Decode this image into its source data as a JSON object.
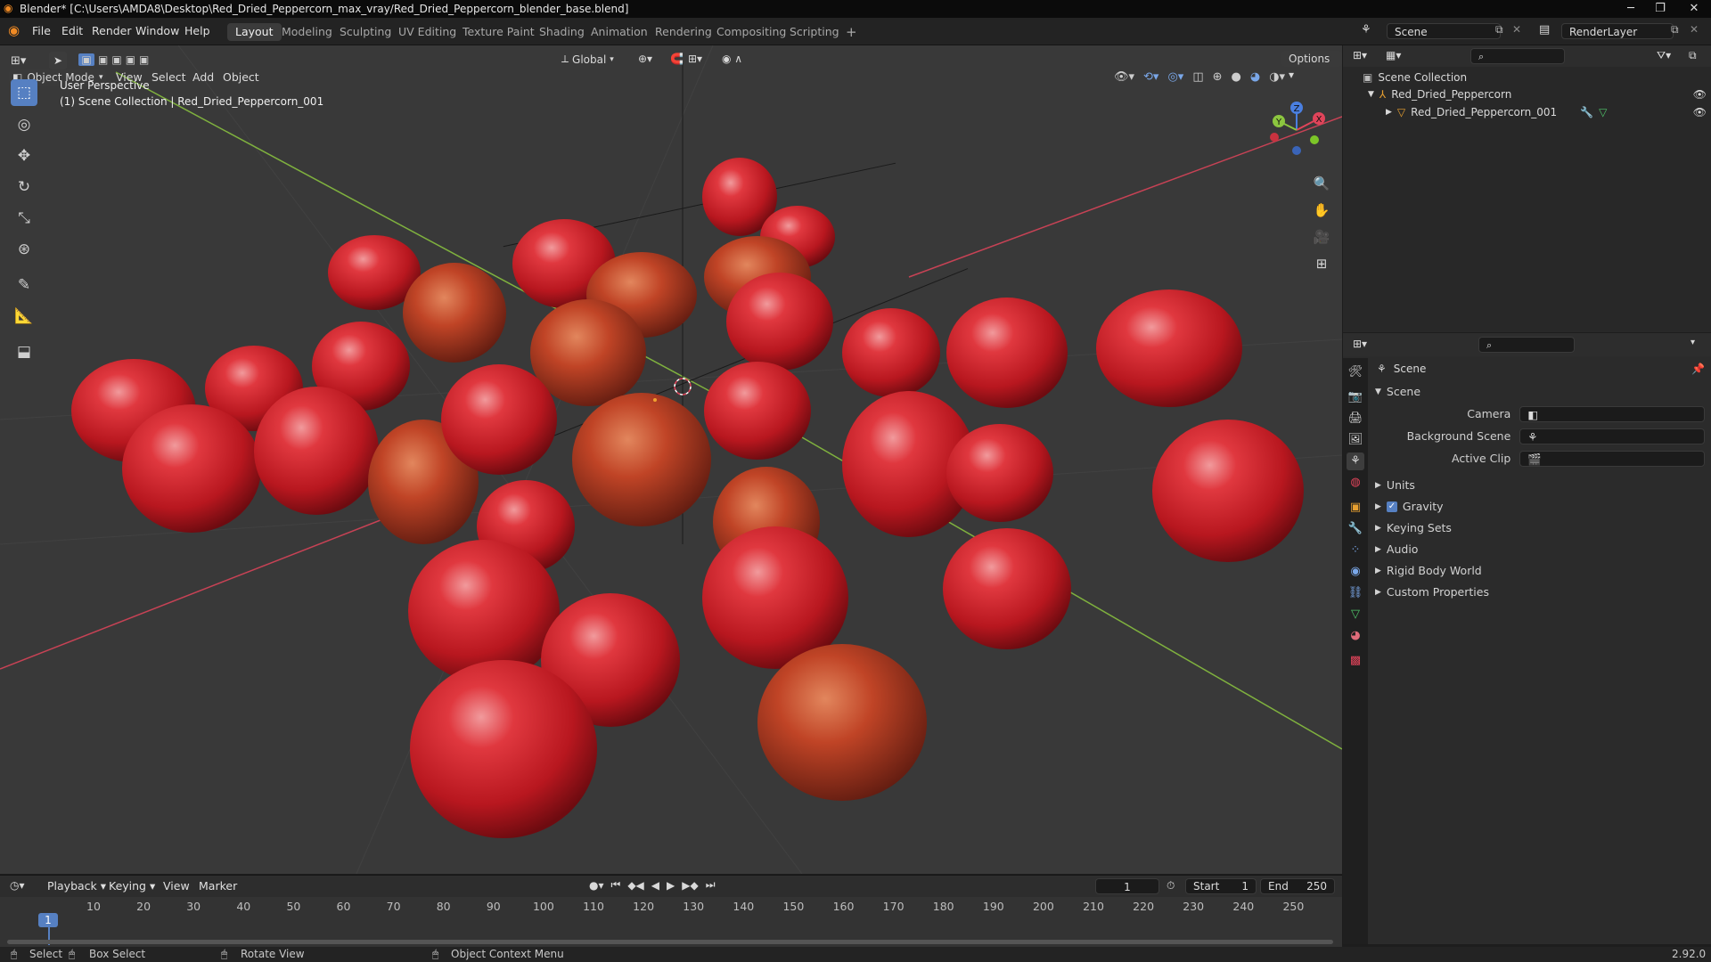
{
  "window": {
    "title": "Blender* [C:\\Users\\AMDA8\\Desktop\\Red_Dried_Peppercorn_max_vray/Red_Dried_Peppercorn_blender_base.blend]"
  },
  "menubar": {
    "items": [
      "File",
      "Edit",
      "Render",
      "Window",
      "Help"
    ]
  },
  "workspaces": [
    "Layout",
    "Modeling",
    "Sculpting",
    "UV Editing",
    "Texture Paint",
    "Shading",
    "Animation",
    "Rendering",
    "Compositing",
    "Scripting"
  ],
  "active_workspace": "Layout",
  "scene_selector": {
    "value": "Scene"
  },
  "renderlayer_selector": {
    "value": "RenderLayer"
  },
  "viewport": {
    "mode": "Object Mode",
    "menus": [
      "View",
      "Select",
      "Add",
      "Object"
    ],
    "transform_orientation": "Global",
    "options_label": "Options",
    "overlay_title": "User Perspective",
    "overlay_subtitle": "(1) Scene Collection | Red_Dried_Peppercorn_001",
    "gizmo_axes": {
      "x": "X",
      "y": "Y",
      "z": "Z"
    }
  },
  "outliner": {
    "root": "Scene Collection",
    "collection": "Red_Dried_Peppercorn",
    "object": "Red_Dried_Peppercorn_001"
  },
  "properties": {
    "header": "Scene",
    "panel": "Scene",
    "fields": [
      {
        "label": "Camera",
        "value": ""
      },
      {
        "label": "Background Scene",
        "value": ""
      },
      {
        "label": "Active Clip",
        "value": ""
      }
    ],
    "subpanels": [
      "Units",
      "Gravity",
      "Keying Sets",
      "Audio",
      "Rigid Body World",
      "Custom Properties"
    ],
    "gravity_checked": true
  },
  "timeline": {
    "menus": [
      "Playback",
      "Keying",
      "View",
      "Marker"
    ],
    "current_frame": "1",
    "start_label": "Start",
    "start": "1",
    "end_label": "End",
    "end": "250",
    "ticks": [
      "1",
      "10",
      "20",
      "30",
      "40",
      "50",
      "60",
      "70",
      "80",
      "90",
      "100",
      "110",
      "120",
      "130",
      "140",
      "150",
      "160",
      "170",
      "180",
      "190",
      "200",
      "210",
      "220",
      "230",
      "240",
      "250"
    ]
  },
  "statusbar": {
    "select": "Select",
    "box_select": "Box Select",
    "rotate_view": "Rotate View",
    "context_menu": "Object Context Menu",
    "version": "2.92.0"
  },
  "colors": {
    "accent": "#5680c2",
    "axis_x": "#e0445a",
    "axis_y": "#8cc63f",
    "axis_z": "#4a7fe0",
    "peppercorn": "#c8232b"
  }
}
